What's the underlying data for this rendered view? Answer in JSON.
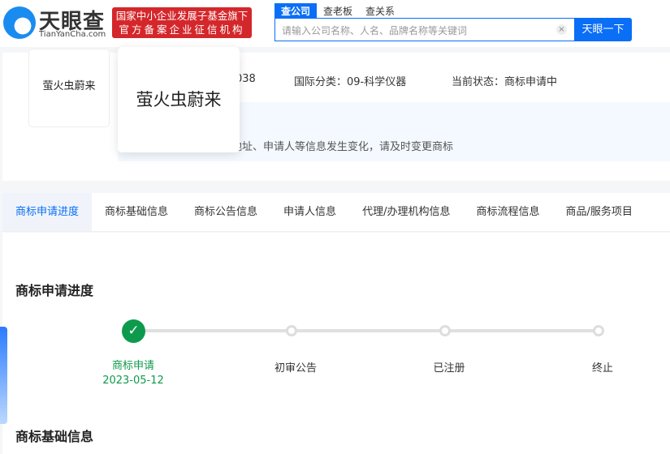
{
  "header": {
    "logo_text": "天眼查",
    "logo_sub": "TianYanCha.com",
    "banner_line1": "国家中小企业发展子基金旗下",
    "banner_line2": "官方备案企业征信机构",
    "search_tabs": [
      "查公司",
      "查老板",
      "查关系"
    ],
    "search_placeholder": "请输入公司名称、人名、品牌名称等关键词",
    "clear_icon": "×",
    "search_button": "天眼一下"
  },
  "trademark": {
    "name": "萤火虫蔚来",
    "reg_no_partial": "038",
    "intl_class": "国际分类：09-科学仪器",
    "status": "当前状态：商标申请中",
    "tip": "地址、申请人等信息发生变化，请及时变更商标"
  },
  "tabs": [
    "商标申请进度",
    "商标基础信息",
    "商标公告信息",
    "申请人信息",
    "代理/办理机构信息",
    "商标流程信息",
    "商品/服务项目"
  ],
  "progress": {
    "title": "商标申请进度",
    "steps": [
      {
        "label": "商标申请",
        "date": "2023-05-12",
        "done": true
      },
      {
        "label": "初审公告",
        "done": false
      },
      {
        "label": "已注册",
        "done": false
      },
      {
        "label": "终止",
        "done": false
      }
    ]
  },
  "section2_title": "商标基础信息",
  "colors": {
    "accent": "#0a6ef7",
    "success": "#0e9a4c",
    "brand_red": "#d4272b"
  }
}
